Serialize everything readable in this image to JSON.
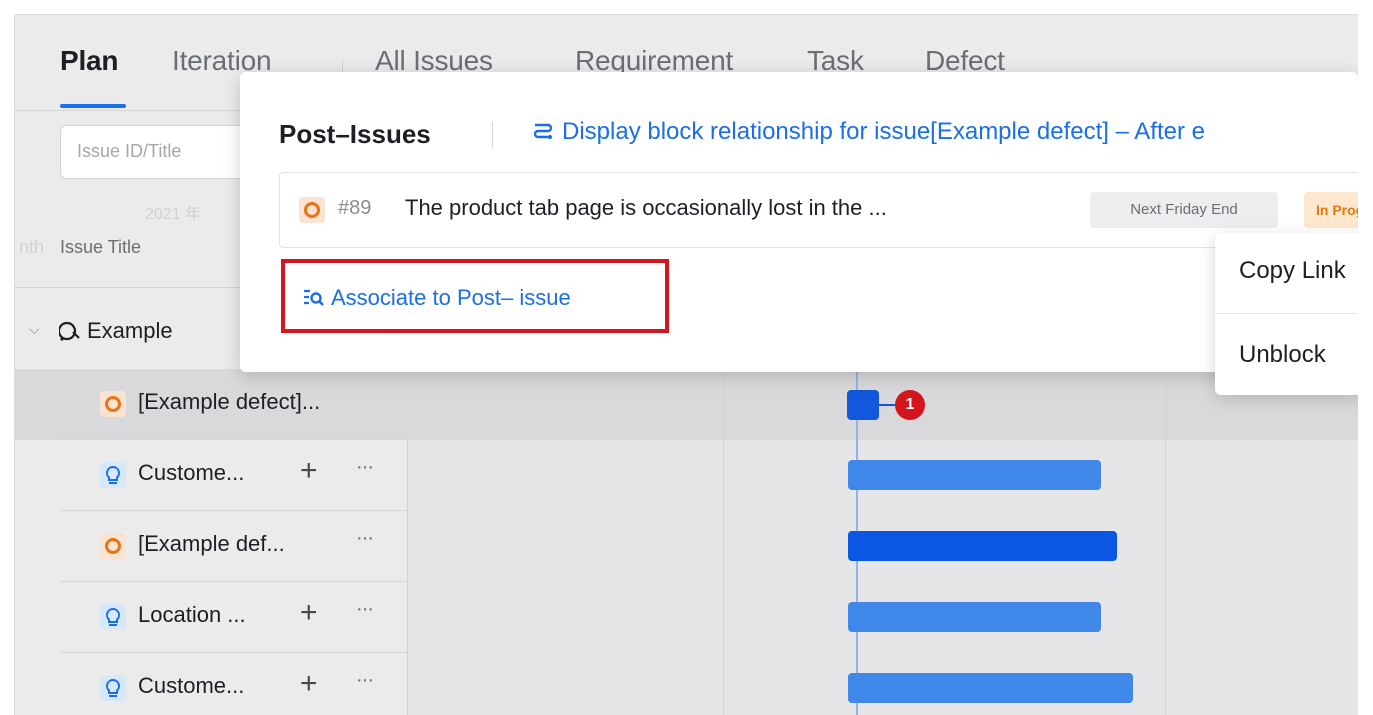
{
  "tabs": [
    {
      "label": "Plan",
      "active": true
    },
    {
      "label": "Iteration",
      "active": false
    },
    {
      "label": "All Issues",
      "active": false
    },
    {
      "label": "Requirement",
      "active": false
    },
    {
      "label": "Task",
      "active": false
    },
    {
      "label": "Defect",
      "active": false
    }
  ],
  "left_pane": {
    "search_placeholder": "Issue ID/Title",
    "faded_date": "2021 年",
    "column_header": "Issue Title",
    "column_header_clipped": "nth",
    "group_label": "Example",
    "rows": [
      {
        "icon": "defect-icon",
        "label": "[Example defect]...",
        "plus": "",
        "more": ""
      },
      {
        "icon": "requirement-icon",
        "label": "Custome...",
        "plus": "+",
        "more": "···"
      },
      {
        "icon": "defect-icon",
        "label": "[Example def...",
        "plus": "",
        "more": "···"
      },
      {
        "icon": "requirement-icon",
        "label": "Location ...",
        "plus": "+",
        "more": "···"
      },
      {
        "icon": "requirement-icon",
        "label": "Custome...",
        "plus": "+",
        "more": "···"
      }
    ]
  },
  "gantt": {
    "dependency_count": "1",
    "colors": {
      "bar_light": "#3f87e8",
      "bar_dark": "#0b57e3",
      "dependency_badge": "#d3161e"
    }
  },
  "popover": {
    "title": "Post–Issues",
    "relationship_link": "Display block relationship for issue[Example defect] – After e",
    "issue": {
      "id": "#89",
      "title": "The product tab page is occasionally lost in the ...",
      "date": "Next Friday End",
      "status": "In Progr"
    },
    "associate_link": "Associate to Post– issue"
  },
  "context_menu": {
    "items": [
      "Copy Link",
      "Unblock"
    ]
  },
  "colors": {
    "accent": "#1a73e8",
    "highlight_border": "#d4161e",
    "defect": "#e8731a",
    "requirement": "#1a6fe8"
  }
}
